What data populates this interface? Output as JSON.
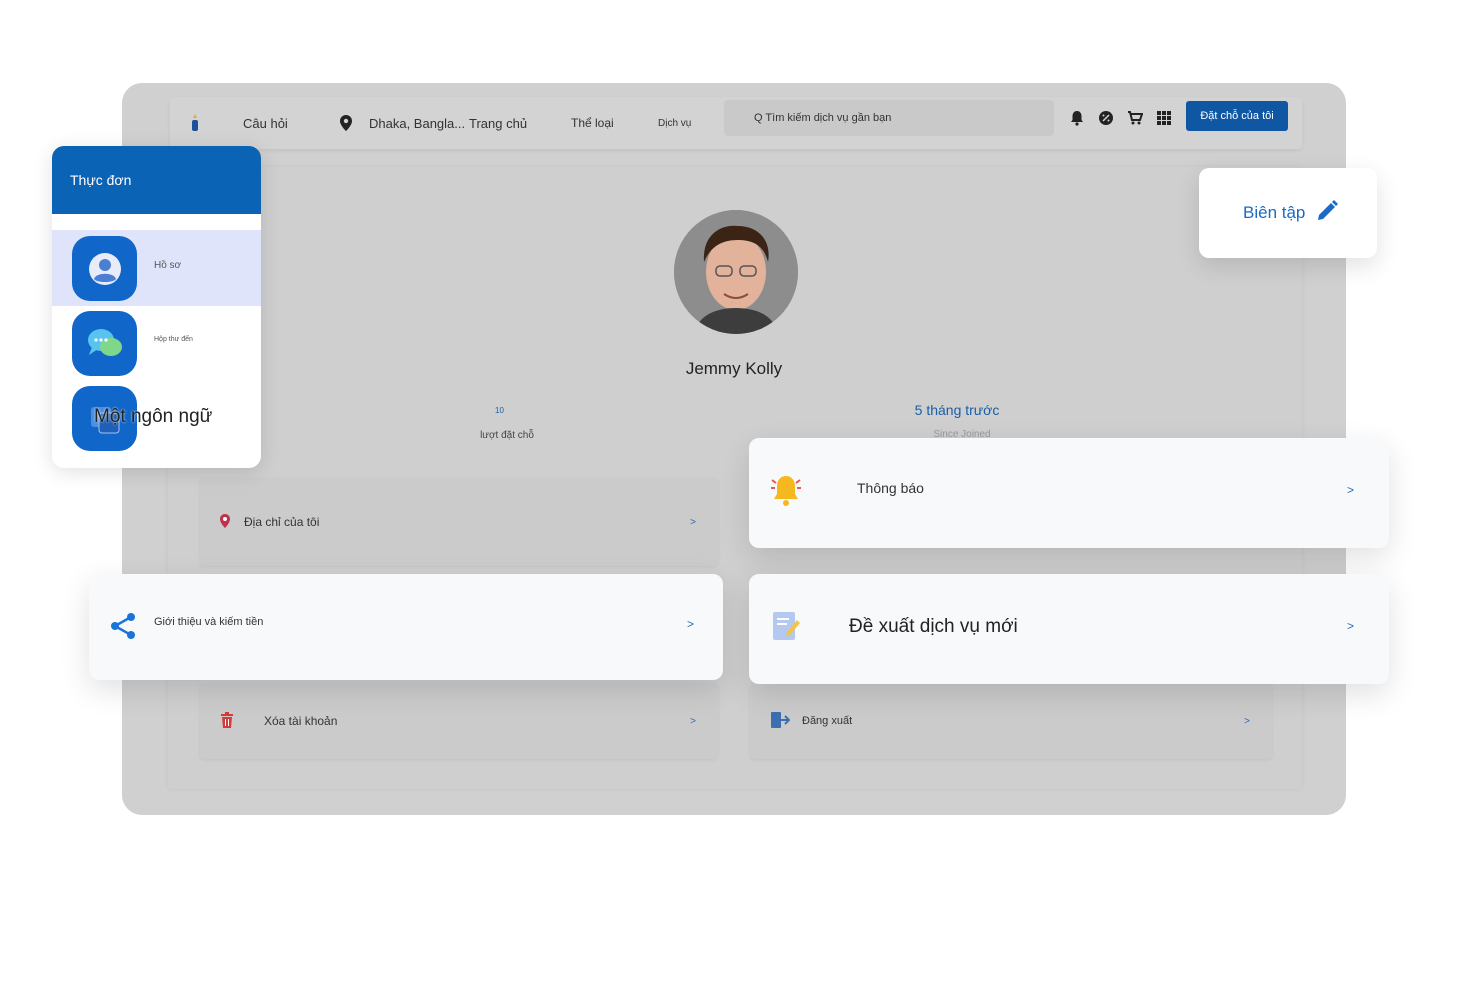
{
  "nav": {
    "faq": "Câu hỏi",
    "location": "Dhaka, Bangla...",
    "home": "Trang chủ",
    "category": "Thể loại",
    "services": "Dịch vụ",
    "search_placeholder": "Q Tìm kiếm dịch vụ gần bạn",
    "book_button": "Đặt chỗ của tôi"
  },
  "profile": {
    "name": "Jemmy Kolly",
    "bookings_count": "10",
    "bookings_label": "lượt đặt chỗ",
    "since_value": "5 tháng trước",
    "since_label": "Since Joined"
  },
  "menu": {
    "title": "Thực đơn",
    "items": [
      {
        "label": "Hồ sơ"
      },
      {
        "label": "Hộp thư đến"
      },
      {
        "label": "Một ngôn ngữ"
      }
    ]
  },
  "edit": {
    "label": "Biên tập"
  },
  "cards": {
    "address": "Địa chỉ của tôi",
    "notifications": "Thông báo",
    "referral": "Giới thiệu và kiếm tiền",
    "suggest": "Đề xuất dịch vụ mới",
    "delete": "Xóa tài khoản",
    "logout": "Đăng xuất",
    "chevron": ">"
  },
  "colors": {
    "accent": "#0b63b6",
    "active_bg": "#dfe4fb",
    "link": "#1a6bc4",
    "danger": "#d63b3b"
  }
}
